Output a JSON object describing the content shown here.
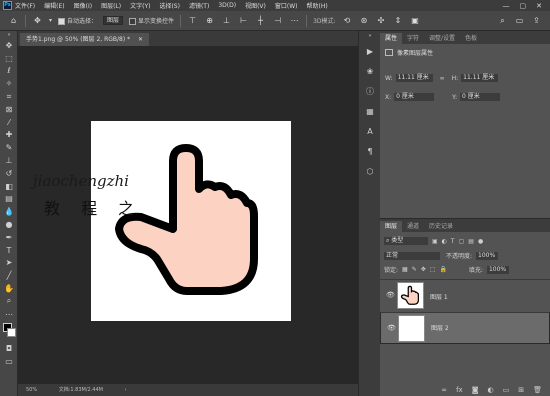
{
  "menubar": {
    "items": [
      "文件(F)",
      "编辑(E)",
      "图像(I)",
      "图层(L)",
      "文字(Y)",
      "选择(S)",
      "滤镜(T)",
      "3D(D)",
      "视图(V)",
      "窗口(W)",
      "帮助(H)"
    ],
    "window_controls": [
      "—",
      "▢",
      "✕"
    ]
  },
  "optionsbar": {
    "auto_select_label": "自动选择：",
    "auto_select_value": "图层",
    "show_transform_label": "显示变换控件"
  },
  "document": {
    "tab_title": "手势1.png @ 50% (图层 2, RGB/8) *",
    "zoom": "50%",
    "doc_info": "文档:1.83M/2.44M"
  },
  "watermark": {
    "line1": "jiaochengzhi",
    "line2": "教 程 之"
  },
  "properties": {
    "tabs": [
      "属性",
      "字符",
      "调整/设置",
      "色板"
    ],
    "section_title": "像素图层属性",
    "w_label": "W:",
    "w_value": "11.11 厘米",
    "link_icon": "link-icon",
    "h_label": "H:",
    "h_value": "11.11 厘米",
    "x_label": "X:",
    "x_value": "0 厘米",
    "y_label": "Y:",
    "y_value": "0 厘米"
  },
  "layers": {
    "tabs": [
      "图层",
      "通道",
      "历史记录"
    ],
    "filter_label": "类型",
    "blend_mode": "正常",
    "opacity_label": "不透明度:",
    "opacity_value": "100%",
    "lock_label": "锁定:",
    "fill_label": "填充:",
    "fill_value": "100%",
    "items": [
      {
        "name": "图层 1",
        "selected": false
      },
      {
        "name": "图层 2",
        "selected": true
      }
    ]
  },
  "colors": {
    "hand_fill": "#fcd2c3",
    "hand_outline": "#000000",
    "canvas_bg": "#282828"
  }
}
